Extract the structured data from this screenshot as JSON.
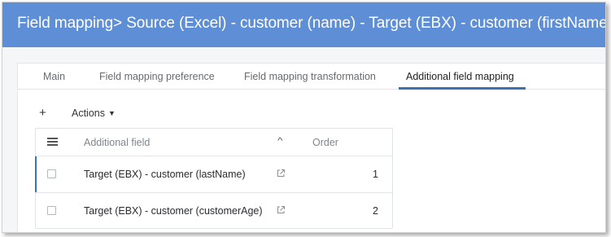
{
  "header": {
    "title": "Field mapping> Source (Excel) - customer (name) - Target (EBX) - customer (firstName)"
  },
  "tabs": [
    {
      "label": "Main",
      "active": false
    },
    {
      "label": "Field mapping preference",
      "active": false
    },
    {
      "label": "Field mapping transformation",
      "active": false
    },
    {
      "label": "Additional field mapping",
      "active": true
    }
  ],
  "toolbar": {
    "add_label": "+",
    "actions_label": "Actions"
  },
  "grid": {
    "columns": [
      "Additional field",
      "Order"
    ],
    "sort_icon": "chevron-up-icon",
    "rows": [
      {
        "field": "Target (EBX) - customer (lastName)",
        "order": "1"
      },
      {
        "field": "Target (EBX) - customer (customerAge)",
        "order": "2"
      }
    ]
  },
  "colors": {
    "header_bg": "#5e8fd6",
    "accent": "#3d6fb6"
  }
}
